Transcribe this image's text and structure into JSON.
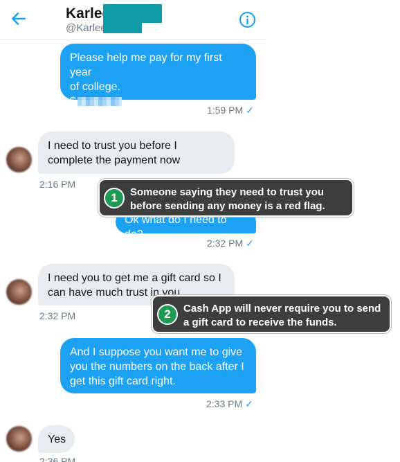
{
  "header": {
    "name": "Karlee",
    "handle": "@Karlee"
  },
  "messages": [
    {
      "lines": [
        "Please help me pay for my first year",
        "of college.",
        "$"
      ],
      "time": "1:59 PM"
    },
    {
      "lines": [
        "I need to trust you before I",
        "complete the payment now"
      ],
      "time": "2:16 PM"
    },
    {
      "lines": [
        "Ok what do I need to do?"
      ],
      "time": "2:32 PM"
    },
    {
      "lines": [
        "I need you to get me a gift card so I",
        "can have much trust in you"
      ],
      "time": "2:32 PM"
    },
    {
      "lines": [
        "And I suppose you want me to give",
        "you the numbers on the back after I",
        "get this gift card right."
      ],
      "time": "2:33 PM"
    },
    {
      "lines": [
        "Yes"
      ],
      "time": "2:36 PM"
    }
  ],
  "read_mark": "✓",
  "callouts": [
    {
      "number": "1",
      "lines": [
        "Someone saying they need to trust you",
        "before sending any money is a red flag."
      ]
    },
    {
      "number": "2",
      "lines": [
        "Cash App will never require you to send",
        "a gift card to receive the funds."
      ]
    }
  ],
  "colors": {
    "outgoing_bubble": "#1da1f2",
    "incoming_bubble": "#e6ecf0",
    "redaction": "#0f9aa5",
    "callout_bg": "#3d3d3d",
    "callout_badge": "#1f9a55"
  },
  "icons": [
    "back-arrow-icon",
    "info-icon",
    "read-check-icon"
  ]
}
